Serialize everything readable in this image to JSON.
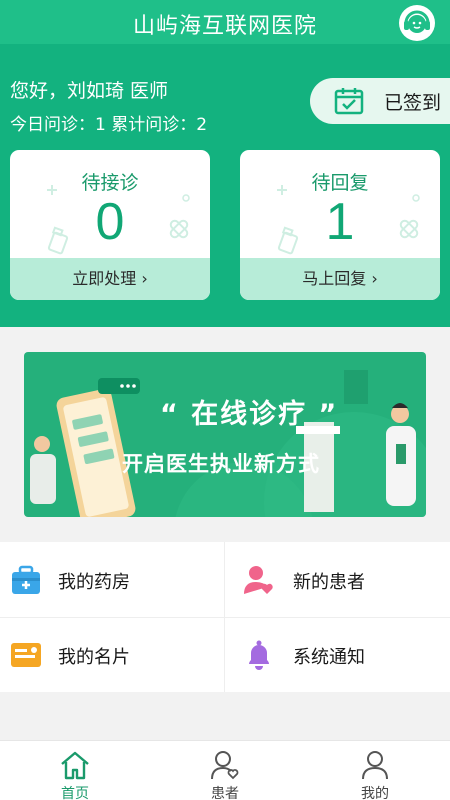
{
  "app": {
    "title": "山屿海互联网医院",
    "accent": "#13b27f"
  },
  "header": {
    "greeting": "您好，刘如琦 医师",
    "stats": "今日问诊：1  累计问诊：2",
    "signin_label": "已签到"
  },
  "cards": {
    "pending": {
      "title": "待接诊",
      "count": "0",
      "action": "立即处理 ›"
    },
    "reply": {
      "title": "待回复",
      "count": "1",
      "action": "马上回复 ›"
    }
  },
  "banner": {
    "headline": "“ 在线诊疗 ”",
    "tagline": "开启医生执业新方式"
  },
  "grid": {
    "pharmacy": "我的药房",
    "new_patients": "新的患者",
    "business_card": "我的名片",
    "notifications": "系统通知"
  },
  "tabs": [
    {
      "label": "首页",
      "icon": "home-icon",
      "active": true
    },
    {
      "label": "患者",
      "icon": "patient-icon",
      "active": false
    },
    {
      "label": "我的",
      "icon": "profile-icon",
      "active": false
    }
  ]
}
